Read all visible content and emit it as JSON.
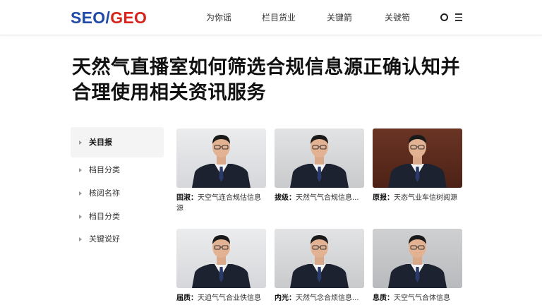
{
  "header": {
    "logo": {
      "seo": "SEO",
      "slash": "/",
      "geo": "GEO"
    },
    "nav": [
      "为你谣",
      "栏目货业",
      "关键箭",
      "关號筍"
    ]
  },
  "page": {
    "title": "天然气直播室如何筛选合规信息源正确认知并合理使用相关资讯服务"
  },
  "sidebar": {
    "items": [
      {
        "label": "关目报"
      },
      {
        "label": "档目分类"
      },
      {
        "label": "核闼名祢"
      },
      {
        "label": "档目分类"
      },
      {
        "label": "关键说好"
      }
    ]
  },
  "cards": [
    {
      "tag": "固淑：",
      "text": "天空气连合规估信息源",
      "bg": "light"
    },
    {
      "tag": "拔级：",
      "text": "天然气气合规信息...",
      "bg": "mid"
    },
    {
      "tag": "原报：",
      "text": "天态气业车信树阅源",
      "bg": "brown"
    },
    {
      "tag": "届质：",
      "text": "天迫气气合业佚信息",
      "bg": "light"
    },
    {
      "tag": "内光：",
      "text": "天然气念合烦信息...",
      "bg": "mid"
    },
    {
      "tag": "息质：",
      "text": "天空气气合体信息",
      "bg": "grey"
    }
  ]
}
